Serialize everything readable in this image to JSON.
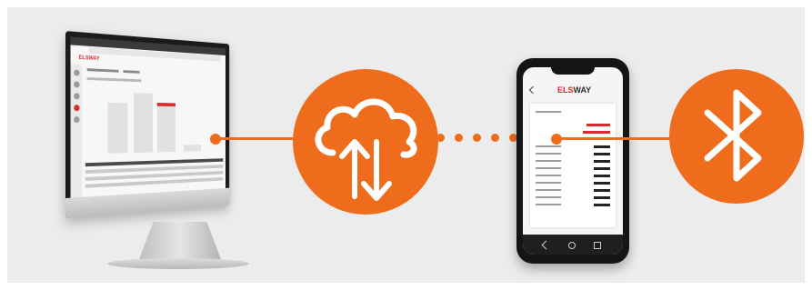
{
  "illustration": {
    "accent_color": "#ee6c1c",
    "background_color": "#ececec",
    "monitor_app": {
      "brand": "ELSWAY"
    },
    "phone_app": {
      "brand_prefix": "ELS",
      "brand_suffix": "WAY"
    },
    "icons": [
      "cloud-upload-download-icon",
      "bluetooth-icon"
    ]
  }
}
